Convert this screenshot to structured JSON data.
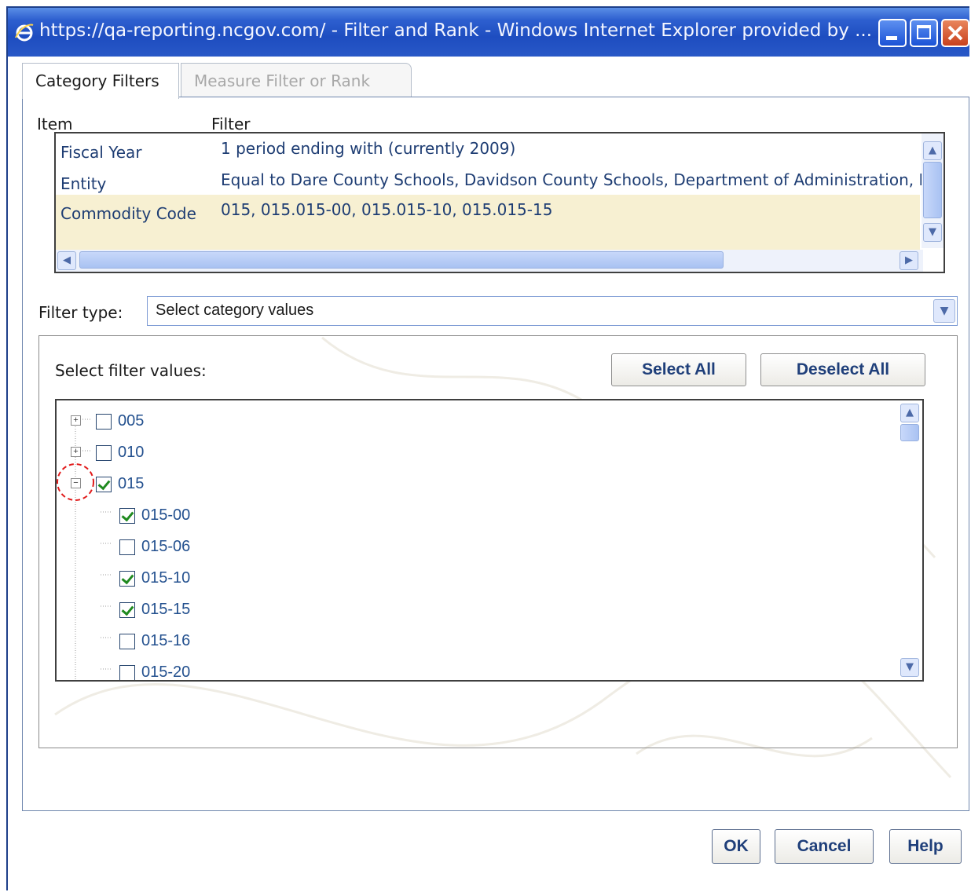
{
  "window": {
    "title": "https://qa-reporting.ncgov.com/ - Filter and Rank - Windows Internet Explorer provided by ..."
  },
  "tabs": [
    {
      "label": "Category Filters",
      "active": true
    },
    {
      "label": "Measure Filter or Rank",
      "active": false
    }
  ],
  "filter_table": {
    "headers": {
      "item": "Item",
      "filter": "Filter"
    },
    "rows": [
      {
        "item": "Fiscal Year",
        "filter": "1 period ending with  (currently 2009)"
      },
      {
        "item": "Entity",
        "filter": "Equal to Dare County Schools, Davidson County Schools, Department of Administration, D"
      },
      {
        "item": "Commodity Code",
        "filter": "015, 015.015-00, 015.015-10, 015.015-15"
      }
    ]
  },
  "filter_type": {
    "label": "Filter type:",
    "value": "Select category values"
  },
  "values_panel": {
    "label": "Select filter values:",
    "select_all": "Select All",
    "deselect_all": "Deselect All",
    "tree": [
      {
        "label": "005",
        "checked": false,
        "expander": "+",
        "level": 0
      },
      {
        "label": "010",
        "checked": false,
        "expander": "+",
        "level": 0
      },
      {
        "label": "015",
        "checked": true,
        "expander": "-",
        "level": 0
      },
      {
        "label": "015-00",
        "checked": true,
        "level": 1
      },
      {
        "label": "015-06",
        "checked": false,
        "level": 1
      },
      {
        "label": "015-10",
        "checked": true,
        "level": 1
      },
      {
        "label": "015-15",
        "checked": true,
        "level": 1
      },
      {
        "label": "015-16",
        "checked": false,
        "level": 1
      },
      {
        "label": "015-20",
        "checked": false,
        "level": 1
      }
    ]
  },
  "footer": {
    "ok": "OK",
    "cancel": "Cancel",
    "help": "Help"
  },
  "colors": {
    "titlebar": "#2d5fcf",
    "link_text": "#1e3d73",
    "highlight_row": "#f7f0d2",
    "check": "#1f8a1f",
    "annotation_circle": "#e11b1b"
  }
}
